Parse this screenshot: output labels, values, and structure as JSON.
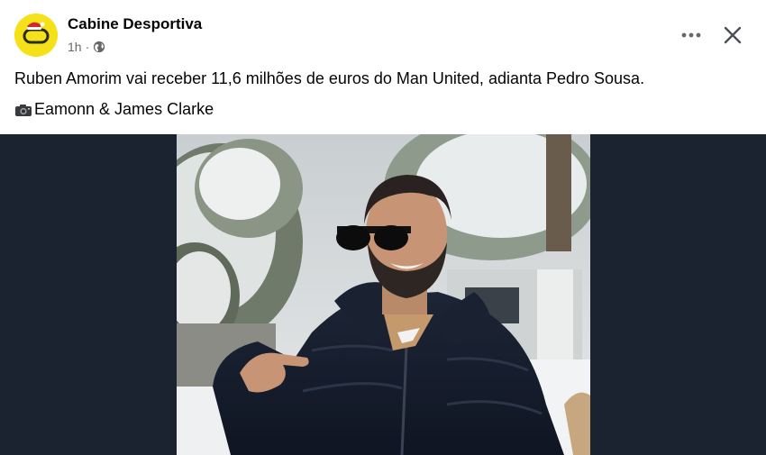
{
  "post": {
    "page_name": "Cabine Desportiva",
    "time": "1h",
    "separator": "·",
    "privacy_icon": "globe-icon",
    "caption": "Ruben Amorim vai receber 11,6 milhões de euros do Man United, adianta Pedro Sousa.",
    "credit": "Eamonn & James Clarke",
    "credit_icon": "camera-icon"
  },
  "actions": {
    "more_icon": "more-icon",
    "close_icon": "close-icon"
  },
  "colors": {
    "avatar_bg": "#f5e11a",
    "logo_red": "#d6262b",
    "media_bg": "#1c2330",
    "text": "#050505",
    "meta": "#65676b"
  }
}
